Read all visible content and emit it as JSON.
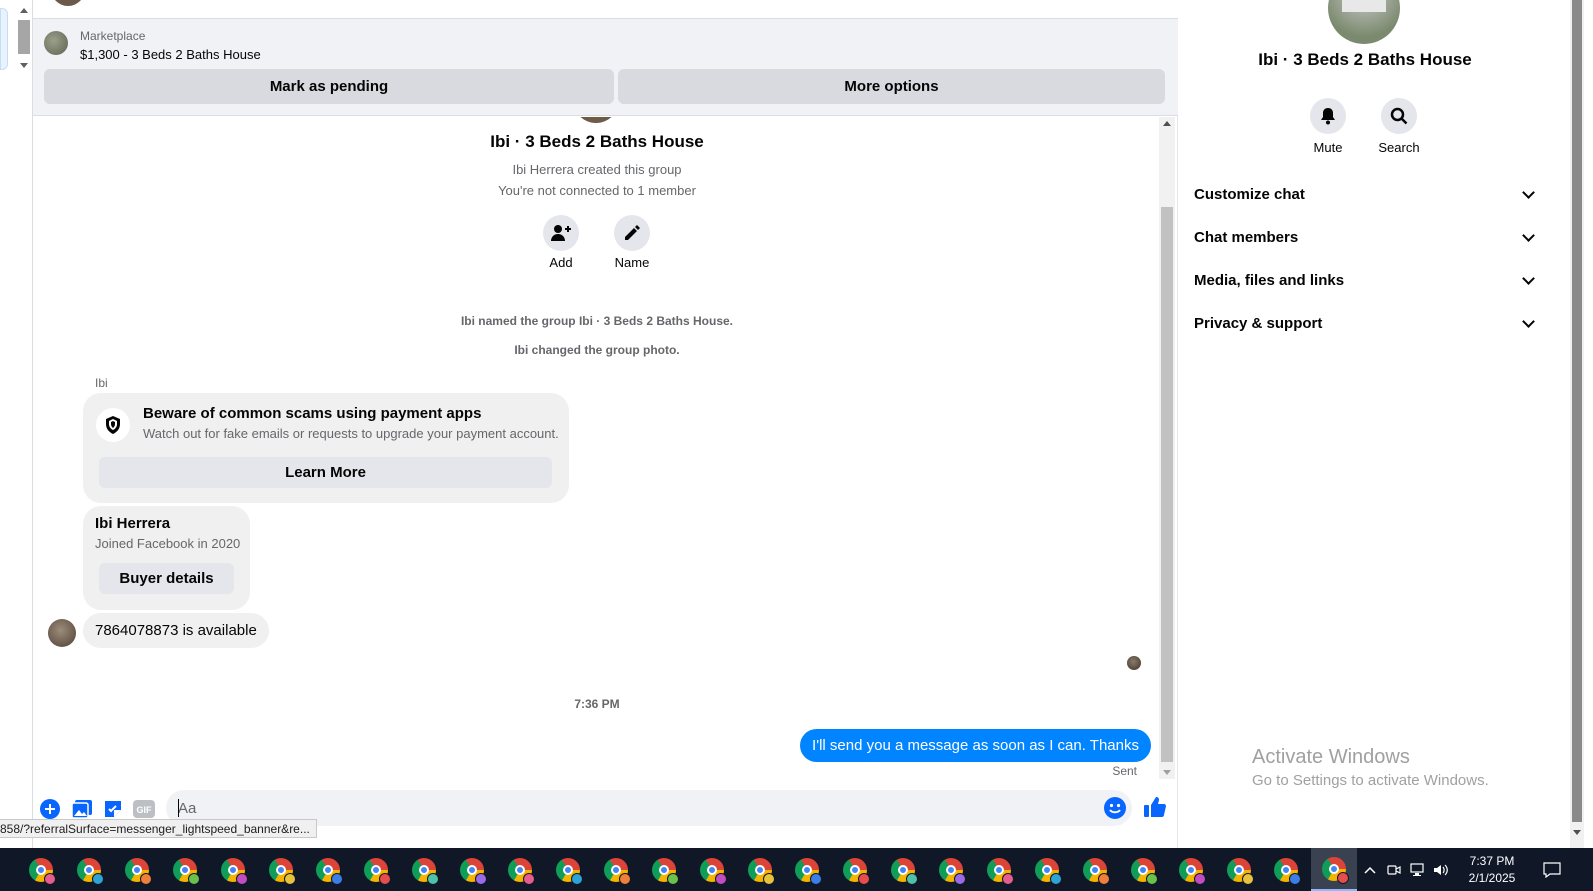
{
  "header": {
    "marketplace_label": "Marketplace",
    "listing_title": "$1,300 - 3 Beds 2 Baths House",
    "mark_pending": "Mark as pending",
    "more_options": "More options"
  },
  "group": {
    "name": "Ibi · 3 Beds 2 Baths House",
    "created_by": "Ibi Herrera created this group",
    "connection": "You're not connected to 1 member",
    "add_label": "Add",
    "name_label": "Name"
  },
  "system_messages": [
    "Ibi named the group Ibi · 3 Beds 2 Baths House.",
    "Ibi changed the group photo."
  ],
  "messages": {
    "sender": "Ibi",
    "scam_title": "Beware of common scams using payment apps",
    "scam_sub": "Watch out for fake emails or requests to upgrade your payment account.",
    "learn_more": "Learn More",
    "buyer_name": "Ibi Herrera",
    "buyer_joined": "Joined Facebook in 2020",
    "buyer_details": "Buyer details",
    "available": "7864078873 is available",
    "timestamp": "7:36 PM",
    "outgoing": "I'll send you a message as soon as I can. Thanks",
    "sent_status": "Sent"
  },
  "composer": {
    "placeholder": "Aa",
    "icons": [
      "plus-circle-icon",
      "image-icon",
      "sticker-icon",
      "gif-icon",
      "emoji-icon",
      "thumbs-up-icon"
    ]
  },
  "status_url": "858/?referralSurface=messenger_lightspeed_banner&re...",
  "right_panel": {
    "title": "Ibi · 3 Beds 2 Baths House",
    "mute": "Mute",
    "search": "Search",
    "sections": [
      "Customize chat",
      "Chat members",
      "Media, files and links",
      "Privacy & support"
    ]
  },
  "watermark": {
    "title": "Activate Windows",
    "sub": "Go to Settings to activate Windows."
  },
  "taskbar": {
    "time": "7:37 PM",
    "date": "2/1/2025"
  },
  "colors": {
    "accent": "#0084ff",
    "taskbar": "#101827"
  }
}
